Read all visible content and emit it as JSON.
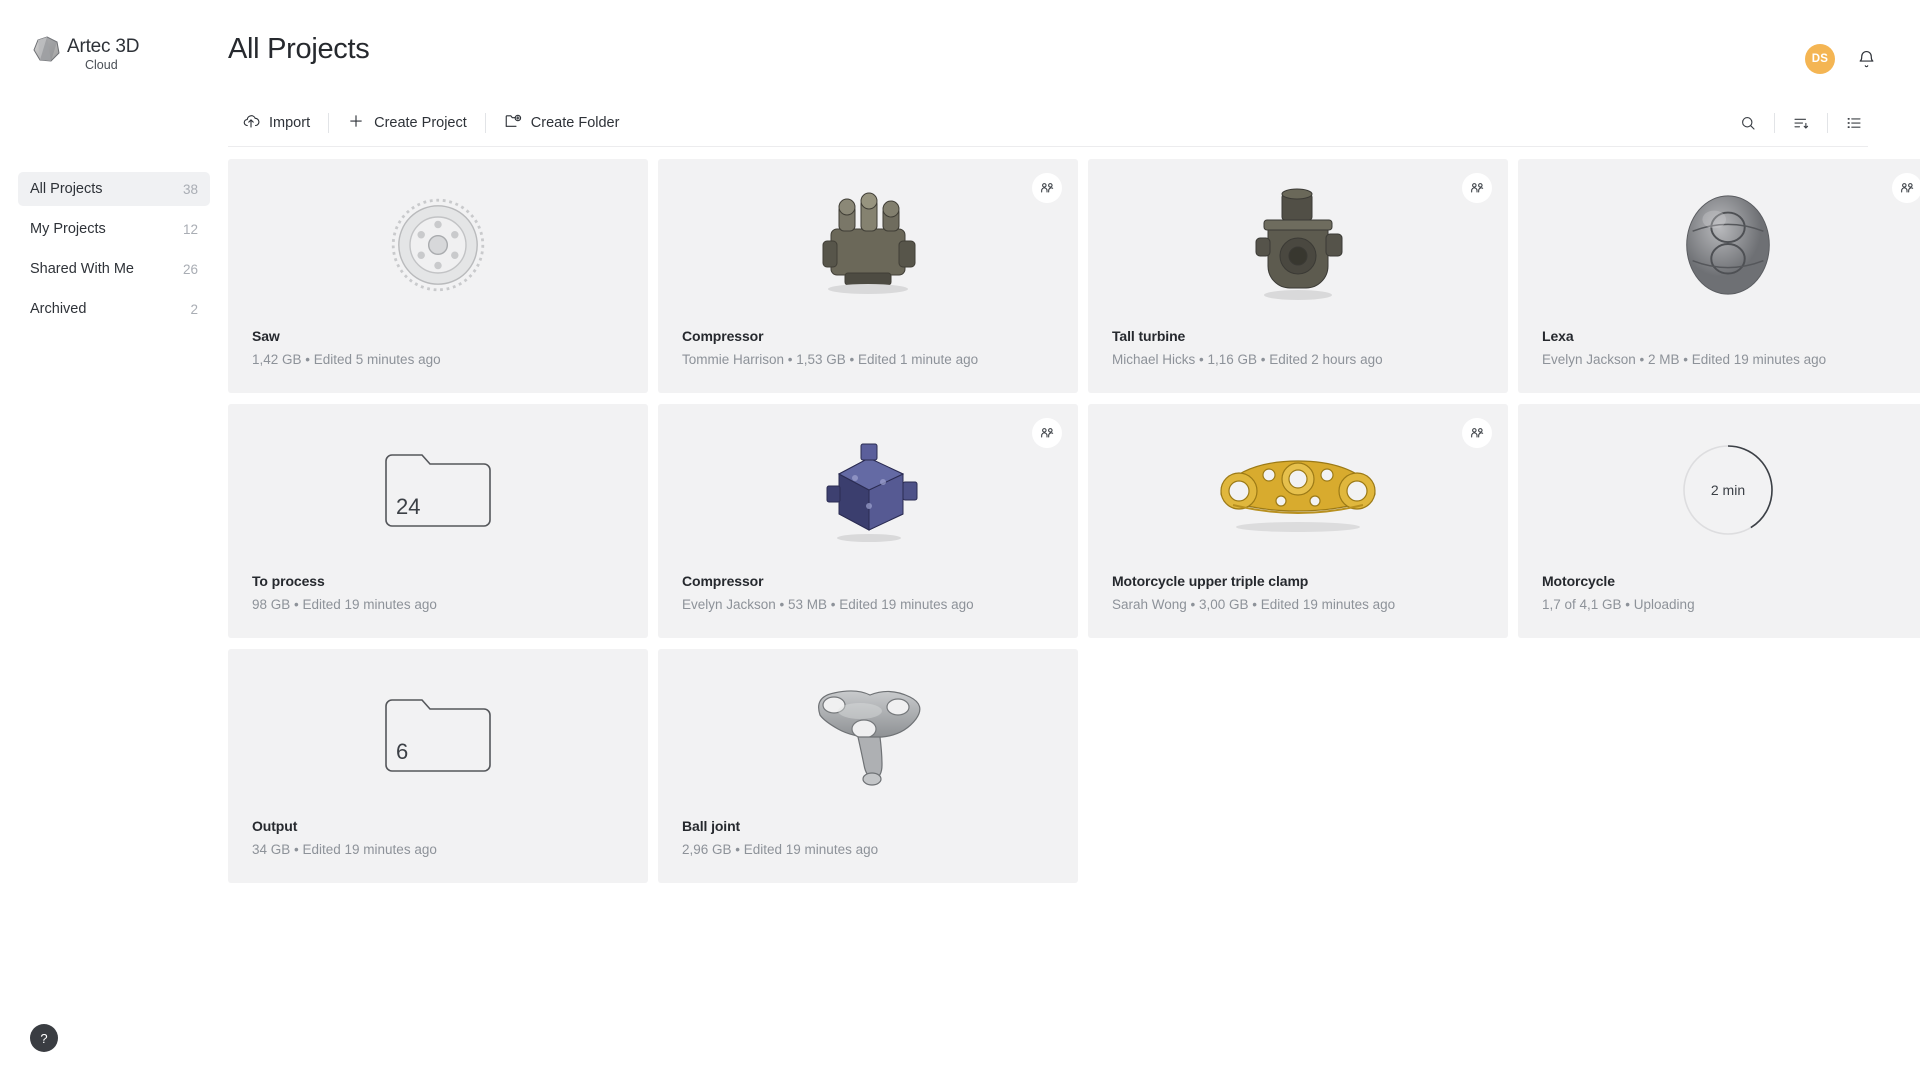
{
  "brand": {
    "name": "Artec 3D",
    "sub": "Cloud",
    "logo_icon": "artec-polyhedron-logo"
  },
  "header": {
    "title": "All Projects",
    "avatar_initials": "DS",
    "avatar_color": "#f4b553",
    "bell_icon": "bell-icon"
  },
  "sidebar": {
    "items": [
      {
        "label": "All Projects",
        "count": "38",
        "active": true
      },
      {
        "label": "My Projects",
        "count": "12",
        "active": false
      },
      {
        "label": "Shared With Me",
        "count": "26",
        "active": false
      },
      {
        "label": "Archived",
        "count": "2",
        "active": false
      }
    ]
  },
  "toolbar": {
    "import_label": "Import",
    "import_icon": "cloud-upload-icon",
    "create_project_label": "Create Project",
    "create_project_icon": "plus-icon",
    "create_folder_label": "Create Folder",
    "create_folder_icon": "folder-plus-icon",
    "search_icon": "search-icon",
    "sort_icon": "sort-descending-icon",
    "view_icon": "list-view-icon"
  },
  "help": {
    "label": "?",
    "icon": "question-mark-icon"
  },
  "projects": [
    {
      "name": "Saw",
      "sub": "1,42 GB • Edited 5 minutes ago",
      "thumb": "saw",
      "shared": false
    },
    {
      "name": "Compressor",
      "sub": "Tommie Harrison • 1,53 GB • Edited 1 minute ago",
      "thumb": "compressor",
      "shared": true
    },
    {
      "name": "Tall turbine",
      "sub": "Michael Hicks • 1,16 GB • Edited 2 hours ago",
      "thumb": "turbine",
      "shared": true
    },
    {
      "name": "Lexa",
      "sub": "Evelyn Jackson • 2 MB • Edited 19 minutes ago",
      "thumb": "lexa",
      "shared": true
    },
    {
      "name": "To process",
      "sub": "98 GB • Edited 19 minutes ago",
      "thumb": "folder",
      "folder_count": "24",
      "shared": false
    },
    {
      "name": "Compressor",
      "sub": "Evelyn Jackson • 53 MB • Edited 19 minutes ago",
      "thumb": "blue-block",
      "shared": true
    },
    {
      "name": "Motorcycle upper triple clamp",
      "sub": "Sarah Wong • 3,00 GB • Edited 19 minutes ago",
      "thumb": "triple-clamp",
      "shared": true
    },
    {
      "name": "Motorcycle",
      "sub": "1,7 of 4,1 GB • Uploading",
      "thumb": "uploading",
      "upload_time": "2 min",
      "upload_percent": 41,
      "shared": false
    },
    {
      "name": "Output",
      "sub": "34 GB • Edited 19 minutes ago",
      "thumb": "folder",
      "folder_count": "6",
      "shared": false
    },
    {
      "name": "Ball joint",
      "sub": "2,96 GB • Edited 19 minutes ago",
      "thumb": "ball-joint",
      "shared": false
    }
  ]
}
